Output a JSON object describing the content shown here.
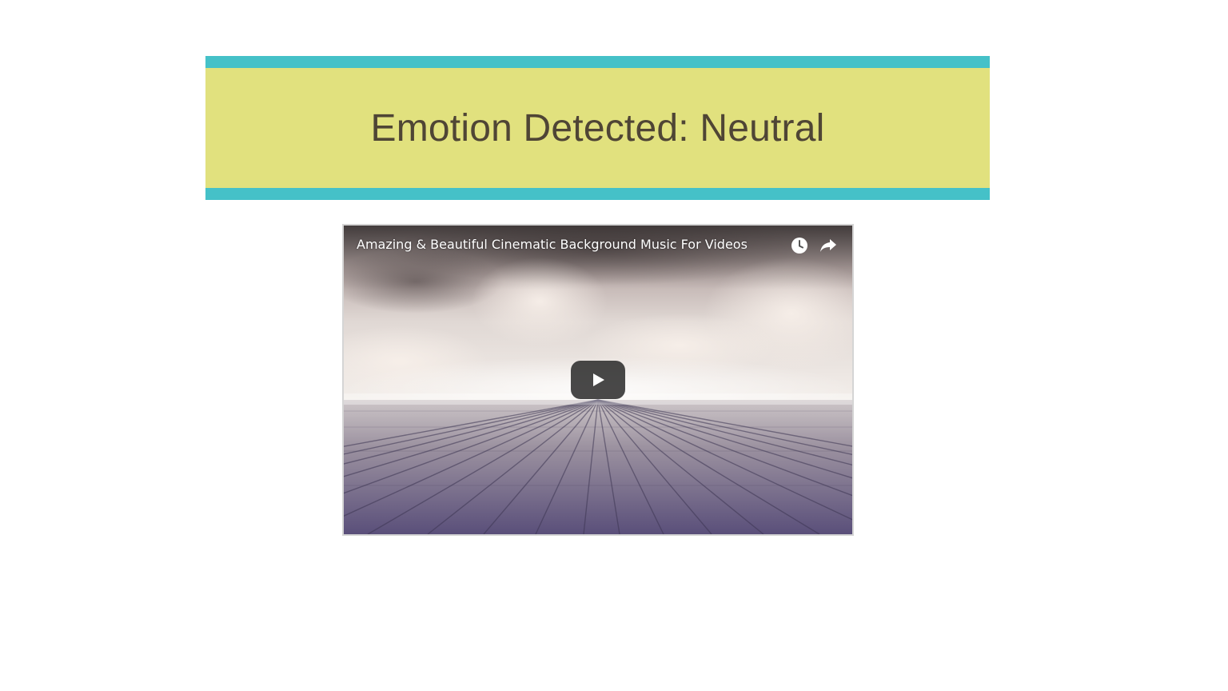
{
  "banner": {
    "title": "Emotion Detected: Neutral",
    "background_color": "#e1e17e",
    "stripe_color": "#45c1c8",
    "text_color": "#4f4535"
  },
  "video": {
    "title": "Amazing & Beautiful Cinematic Background Music For Videos",
    "icons": {
      "watch_later": "clock-icon",
      "share": "share-icon",
      "play": "play-icon"
    }
  }
}
